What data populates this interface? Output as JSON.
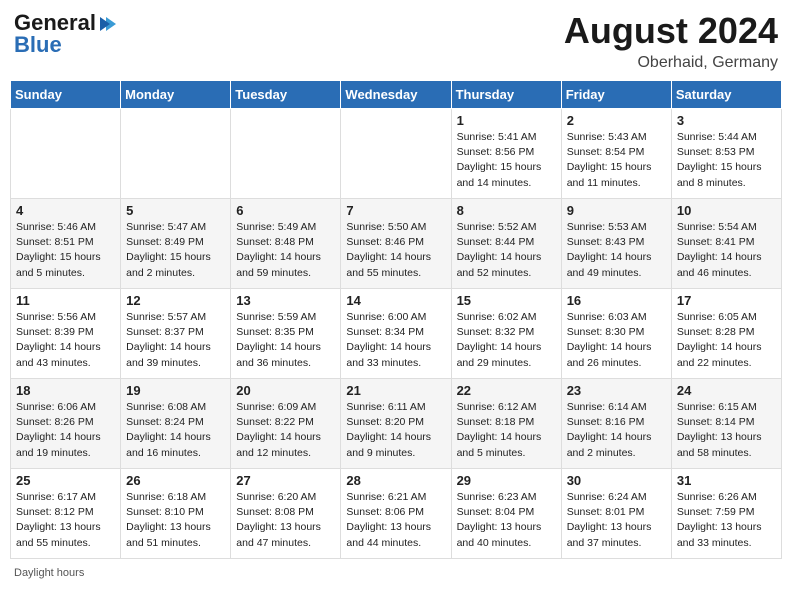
{
  "header": {
    "logo_line1": "General",
    "logo_line2": "Blue",
    "month": "August 2024",
    "location": "Oberhaid, Germany"
  },
  "days_of_week": [
    "Sunday",
    "Monday",
    "Tuesday",
    "Wednesday",
    "Thursday",
    "Friday",
    "Saturday"
  ],
  "footer": {
    "label": "Daylight hours"
  },
  "weeks": [
    [
      {
        "day": "",
        "info": ""
      },
      {
        "day": "",
        "info": ""
      },
      {
        "day": "",
        "info": ""
      },
      {
        "day": "",
        "info": ""
      },
      {
        "day": "1",
        "info": "Sunrise: 5:41 AM\nSunset: 8:56 PM\nDaylight: 15 hours\nand 14 minutes."
      },
      {
        "day": "2",
        "info": "Sunrise: 5:43 AM\nSunset: 8:54 PM\nDaylight: 15 hours\nand 11 minutes."
      },
      {
        "day": "3",
        "info": "Sunrise: 5:44 AM\nSunset: 8:53 PM\nDaylight: 15 hours\nand 8 minutes."
      }
    ],
    [
      {
        "day": "4",
        "info": "Sunrise: 5:46 AM\nSunset: 8:51 PM\nDaylight: 15 hours\nand 5 minutes."
      },
      {
        "day": "5",
        "info": "Sunrise: 5:47 AM\nSunset: 8:49 PM\nDaylight: 15 hours\nand 2 minutes."
      },
      {
        "day": "6",
        "info": "Sunrise: 5:49 AM\nSunset: 8:48 PM\nDaylight: 14 hours\nand 59 minutes."
      },
      {
        "day": "7",
        "info": "Sunrise: 5:50 AM\nSunset: 8:46 PM\nDaylight: 14 hours\nand 55 minutes."
      },
      {
        "day": "8",
        "info": "Sunrise: 5:52 AM\nSunset: 8:44 PM\nDaylight: 14 hours\nand 52 minutes."
      },
      {
        "day": "9",
        "info": "Sunrise: 5:53 AM\nSunset: 8:43 PM\nDaylight: 14 hours\nand 49 minutes."
      },
      {
        "day": "10",
        "info": "Sunrise: 5:54 AM\nSunset: 8:41 PM\nDaylight: 14 hours\nand 46 minutes."
      }
    ],
    [
      {
        "day": "11",
        "info": "Sunrise: 5:56 AM\nSunset: 8:39 PM\nDaylight: 14 hours\nand 43 minutes."
      },
      {
        "day": "12",
        "info": "Sunrise: 5:57 AM\nSunset: 8:37 PM\nDaylight: 14 hours\nand 39 minutes."
      },
      {
        "day": "13",
        "info": "Sunrise: 5:59 AM\nSunset: 8:35 PM\nDaylight: 14 hours\nand 36 minutes."
      },
      {
        "day": "14",
        "info": "Sunrise: 6:00 AM\nSunset: 8:34 PM\nDaylight: 14 hours\nand 33 minutes."
      },
      {
        "day": "15",
        "info": "Sunrise: 6:02 AM\nSunset: 8:32 PM\nDaylight: 14 hours\nand 29 minutes."
      },
      {
        "day": "16",
        "info": "Sunrise: 6:03 AM\nSunset: 8:30 PM\nDaylight: 14 hours\nand 26 minutes."
      },
      {
        "day": "17",
        "info": "Sunrise: 6:05 AM\nSunset: 8:28 PM\nDaylight: 14 hours\nand 22 minutes."
      }
    ],
    [
      {
        "day": "18",
        "info": "Sunrise: 6:06 AM\nSunset: 8:26 PM\nDaylight: 14 hours\nand 19 minutes."
      },
      {
        "day": "19",
        "info": "Sunrise: 6:08 AM\nSunset: 8:24 PM\nDaylight: 14 hours\nand 16 minutes."
      },
      {
        "day": "20",
        "info": "Sunrise: 6:09 AM\nSunset: 8:22 PM\nDaylight: 14 hours\nand 12 minutes."
      },
      {
        "day": "21",
        "info": "Sunrise: 6:11 AM\nSunset: 8:20 PM\nDaylight: 14 hours\nand 9 minutes."
      },
      {
        "day": "22",
        "info": "Sunrise: 6:12 AM\nSunset: 8:18 PM\nDaylight: 14 hours\nand 5 minutes."
      },
      {
        "day": "23",
        "info": "Sunrise: 6:14 AM\nSunset: 8:16 PM\nDaylight: 14 hours\nand 2 minutes."
      },
      {
        "day": "24",
        "info": "Sunrise: 6:15 AM\nSunset: 8:14 PM\nDaylight: 13 hours\nand 58 minutes."
      }
    ],
    [
      {
        "day": "25",
        "info": "Sunrise: 6:17 AM\nSunset: 8:12 PM\nDaylight: 13 hours\nand 55 minutes."
      },
      {
        "day": "26",
        "info": "Sunrise: 6:18 AM\nSunset: 8:10 PM\nDaylight: 13 hours\nand 51 minutes."
      },
      {
        "day": "27",
        "info": "Sunrise: 6:20 AM\nSunset: 8:08 PM\nDaylight: 13 hours\nand 47 minutes."
      },
      {
        "day": "28",
        "info": "Sunrise: 6:21 AM\nSunset: 8:06 PM\nDaylight: 13 hours\nand 44 minutes."
      },
      {
        "day": "29",
        "info": "Sunrise: 6:23 AM\nSunset: 8:04 PM\nDaylight: 13 hours\nand 40 minutes."
      },
      {
        "day": "30",
        "info": "Sunrise: 6:24 AM\nSunset: 8:01 PM\nDaylight: 13 hours\nand 37 minutes."
      },
      {
        "day": "31",
        "info": "Sunrise: 6:26 AM\nSunset: 7:59 PM\nDaylight: 13 hours\nand 33 minutes."
      }
    ]
  ]
}
